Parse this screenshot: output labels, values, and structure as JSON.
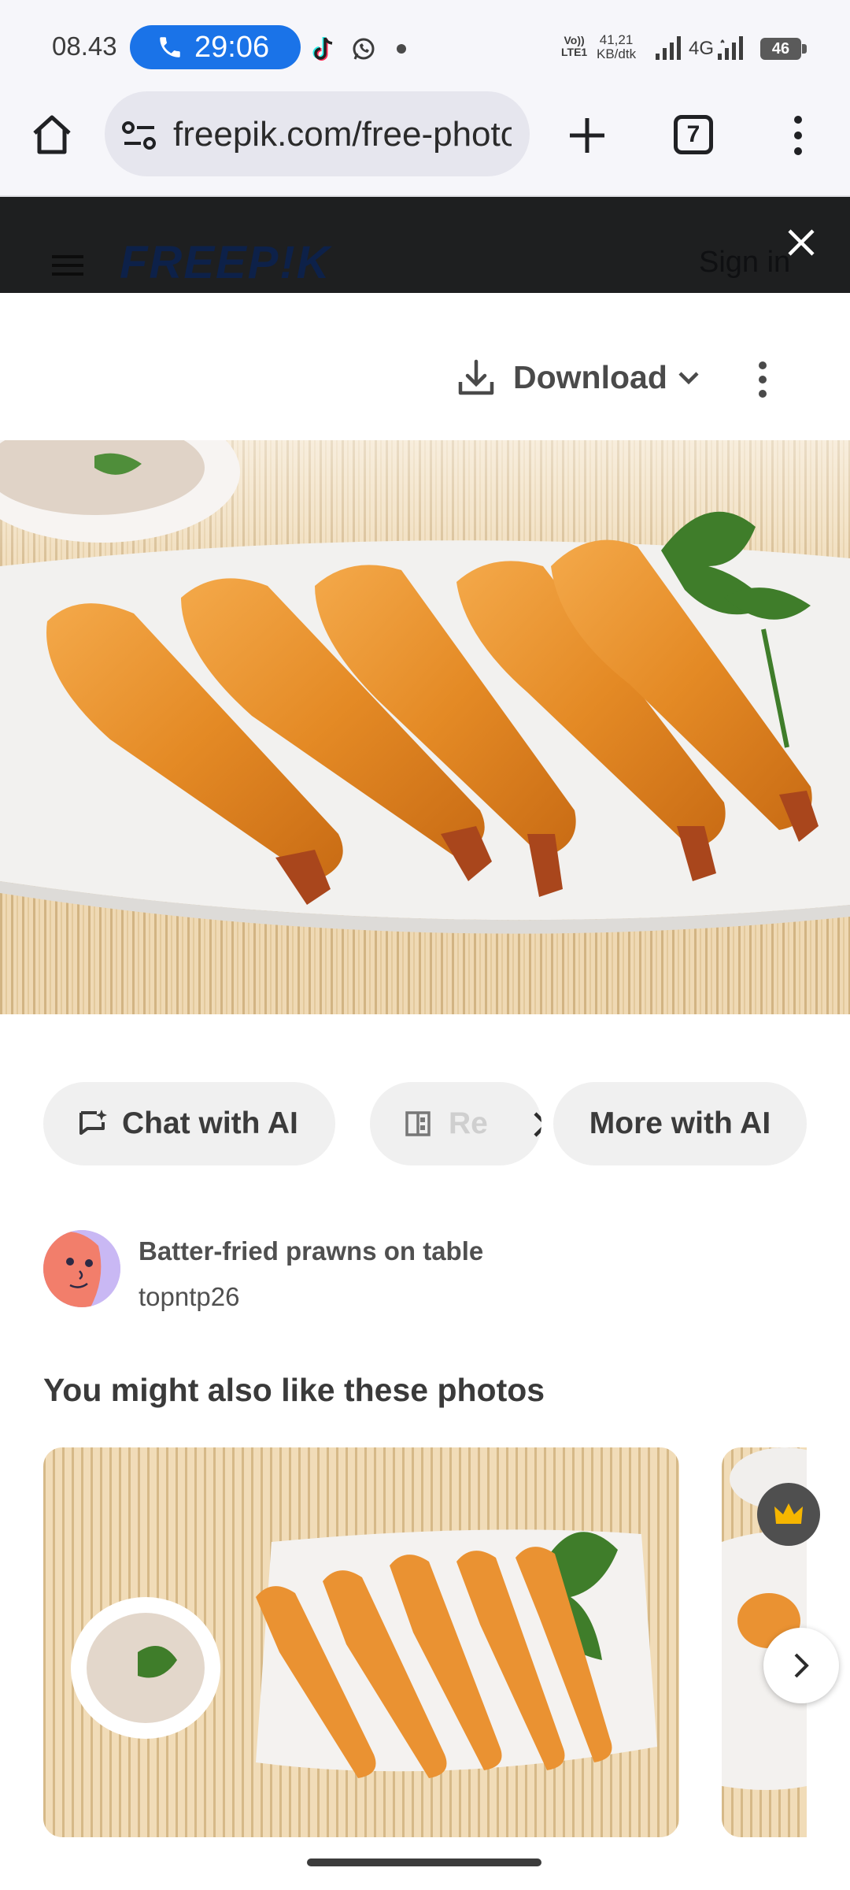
{
  "status_bar": {
    "time": "08.43",
    "call_timer": "29:06",
    "volte_line1": "Vo))",
    "volte_line2": "LTE1",
    "speed_value": "41,21",
    "speed_unit": "KB/dtk",
    "network": "4G",
    "battery": "46"
  },
  "browser": {
    "url": "freepik.com/free-photo/batter-fried-prawns",
    "tab_count": "7"
  },
  "site_header": {
    "logo": "FREEP!K",
    "sign_in": "Sign in"
  },
  "download": {
    "label": "Download"
  },
  "ai_chips": {
    "chat": "Chat with AI",
    "retouch": "Re",
    "more": "More with AI"
  },
  "photo_info": {
    "title": "Batter-fried prawns on table",
    "author": "topntp26"
  },
  "related": {
    "heading": "You might also like these photos"
  },
  "colors": {
    "call_pill": "#1a73e8",
    "header_bg": "#1e1f20",
    "logo": "#0d2149",
    "chip_bg": "#f0f0f0",
    "crown": "#f6b600"
  }
}
